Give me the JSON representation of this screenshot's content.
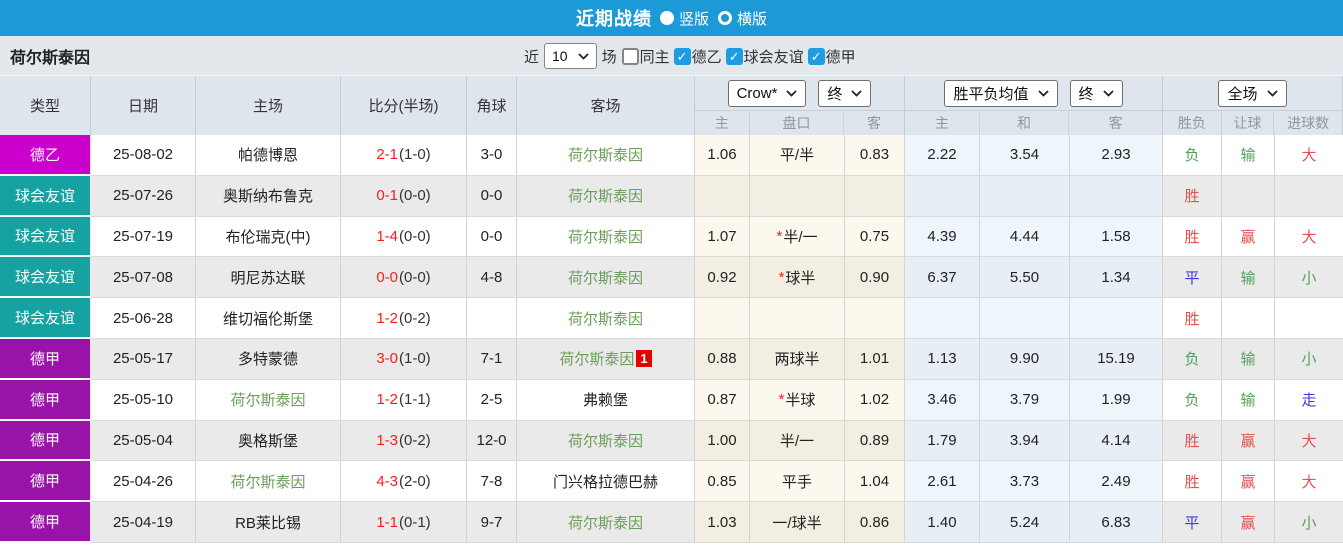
{
  "titlebar": {
    "title": "近期战绩",
    "radios": [
      {
        "label": "竖版",
        "selected": true
      },
      {
        "label": "横版",
        "selected": false
      }
    ]
  },
  "filterbar": {
    "team": "荷尔斯泰因",
    "recent_label": "近",
    "recent_value": "10",
    "games_label": "场",
    "checkboxes": [
      {
        "label": "同主",
        "checked": false
      },
      {
        "label": "德乙",
        "checked": true
      },
      {
        "label": "球会友谊",
        "checked": true
      },
      {
        "label": "德甲",
        "checked": true
      }
    ]
  },
  "table": {
    "headers": {
      "type": "类型",
      "date": "日期",
      "home": "主场",
      "score": "比分(半场)",
      "corner": "角球",
      "away": "客场",
      "odds_sub": [
        "主",
        "盘口",
        "客"
      ],
      "avg_sub": [
        "主",
        "和",
        "客"
      ],
      "result_sub": [
        "胜负",
        "让球",
        "进球数"
      ]
    },
    "dropdowns": {
      "odds_company": "Crow*",
      "odds_final": "终",
      "avg": "胜平负均值",
      "avg_final": "终",
      "scope": "全场"
    },
    "rows": [
      {
        "type": "德乙",
        "type_color": "#cc00cc",
        "date": "25-08-02",
        "home": "帕德博恩",
        "home_team": false,
        "ft": "2-1",
        "ht": "(1-0)",
        "corner": "3-0",
        "away": "荷尔斯泰因",
        "away_team": true,
        "badge": "",
        "o1": "1.06",
        "star": false,
        "line": "平/半",
        "o3": "0.83",
        "a1": "2.22",
        "a2": "3.54",
        "a3": "2.93",
        "result": "负",
        "result_color": "green",
        "handicap": "输",
        "handicap_color": "green",
        "goals": "大",
        "goals_color": "red"
      },
      {
        "type": "球会友谊",
        "type_color": "#17a2a2",
        "date": "25-07-26",
        "home": "奥斯纳布鲁克",
        "home_team": false,
        "ft": "0-1",
        "ht": "(0-0)",
        "corner": "0-0",
        "away": "荷尔斯泰因",
        "away_team": true,
        "badge": "",
        "o1": "",
        "star": false,
        "line": "",
        "o3": "",
        "a1": "",
        "a2": "",
        "a3": "",
        "result": "胜",
        "result_color": "red",
        "handicap": "",
        "handicap_color": "",
        "goals": "",
        "goals_color": ""
      },
      {
        "type": "球会友谊",
        "type_color": "#17a2a2",
        "date": "25-07-19",
        "home": "布伦瑞克(中)",
        "home_team": false,
        "ft": "1-4",
        "ht": "(0-0)",
        "corner": "0-0",
        "away": "荷尔斯泰因",
        "away_team": true,
        "badge": "",
        "o1": "1.07",
        "star": true,
        "line": "半/一",
        "o3": "0.75",
        "a1": "4.39",
        "a2": "4.44",
        "a3": "1.58",
        "result": "胜",
        "result_color": "red",
        "handicap": "赢",
        "handicap_color": "red",
        "goals": "大",
        "goals_color": "red"
      },
      {
        "type": "球会友谊",
        "type_color": "#17a2a2",
        "date": "25-07-08",
        "home": "明尼苏达联",
        "home_team": false,
        "ft": "0-0",
        "ht": "(0-0)",
        "corner": "4-8",
        "away": "荷尔斯泰因",
        "away_team": true,
        "badge": "",
        "o1": "0.92",
        "star": true,
        "line": "球半",
        "o3": "0.90",
        "a1": "6.37",
        "a2": "5.50",
        "a3": "1.34",
        "result": "平",
        "result_color": "blue",
        "handicap": "输",
        "handicap_color": "green",
        "goals": "小",
        "goals_color": "green"
      },
      {
        "type": "球会友谊",
        "type_color": "#17a2a2",
        "date": "25-06-28",
        "home": "维切福伦斯堡",
        "home_team": false,
        "ft": "1-2",
        "ht": "(0-2)",
        "corner": "",
        "away": "荷尔斯泰因",
        "away_team": true,
        "badge": "",
        "o1": "",
        "star": false,
        "line": "",
        "o3": "",
        "a1": "",
        "a2": "",
        "a3": "",
        "result": "胜",
        "result_color": "red",
        "handicap": "",
        "handicap_color": "",
        "goals": "",
        "goals_color": ""
      },
      {
        "type": "德甲",
        "type_color": "#9913a8",
        "date": "25-05-17",
        "home": "多特蒙德",
        "home_team": false,
        "ft": "3-0",
        "ht": "(1-0)",
        "corner": "7-1",
        "away": "荷尔斯泰因",
        "away_team": true,
        "badge": "1",
        "o1": "0.88",
        "star": false,
        "line": "两球半",
        "o3": "1.01",
        "a1": "1.13",
        "a2": "9.90",
        "a3": "15.19",
        "result": "负",
        "result_color": "green",
        "handicap": "输",
        "handicap_color": "green",
        "goals": "小",
        "goals_color": "green"
      },
      {
        "type": "德甲",
        "type_color": "#9913a8",
        "date": "25-05-10",
        "home": "荷尔斯泰因",
        "home_team": true,
        "ft": "1-2",
        "ht": "(1-1)",
        "corner": "2-5",
        "away": "弗赖堡",
        "away_team": false,
        "badge": "",
        "o1": "0.87",
        "star": true,
        "line": "半球",
        "o3": "1.02",
        "a1": "3.46",
        "a2": "3.79",
        "a3": "1.99",
        "result": "负",
        "result_color": "green",
        "handicap": "输",
        "handicap_color": "green",
        "goals": "走",
        "goals_color": "blue"
      },
      {
        "type": "德甲",
        "type_color": "#9913a8",
        "date": "25-05-04",
        "home": "奥格斯堡",
        "home_team": false,
        "ft": "1-3",
        "ht": "(0-2)",
        "corner": "12-0",
        "away": "荷尔斯泰因",
        "away_team": true,
        "badge": "",
        "o1": "1.00",
        "star": false,
        "line": "半/一",
        "o3": "0.89",
        "a1": "1.79",
        "a2": "3.94",
        "a3": "4.14",
        "result": "胜",
        "result_color": "red",
        "handicap": "赢",
        "handicap_color": "red",
        "goals": "大",
        "goals_color": "red"
      },
      {
        "type": "德甲",
        "type_color": "#9913a8",
        "date": "25-04-26",
        "home": "荷尔斯泰因",
        "home_team": true,
        "ft": "4-3",
        "ht": "(2-0)",
        "corner": "7-8",
        "away": "门兴格拉德巴赫",
        "away_team": false,
        "badge": "",
        "o1": "0.85",
        "star": false,
        "line": "平手",
        "o3": "1.04",
        "a1": "2.61",
        "a2": "3.73",
        "a3": "2.49",
        "result": "胜",
        "result_color": "red",
        "handicap": "赢",
        "handicap_color": "red",
        "goals": "大",
        "goals_color": "red"
      },
      {
        "type": "德甲",
        "type_color": "#9913a8",
        "date": "25-04-19",
        "home": "RB莱比锡",
        "home_team": false,
        "ft": "1-1",
        "ht": "(0-1)",
        "corner": "9-7",
        "away": "荷尔斯泰因",
        "away_team": true,
        "badge": "",
        "o1": "1.03",
        "star": false,
        "line": "一/球半",
        "o3": "0.86",
        "a1": "1.40",
        "a2": "5.24",
        "a3": "6.83",
        "result": "平",
        "result_color": "blue",
        "handicap": "赢",
        "handicap_color": "red",
        "goals": "小",
        "goals_color": "green"
      }
    ]
  },
  "colors": {
    "accent_blue": "#1b9ad7",
    "checkbox_blue": "#1e9ce4",
    "type_de2": "#cc00cc",
    "type_friendly": "#17a2a2",
    "type_de1": "#9913a8",
    "team_green": "#6b9e5a",
    "score_red": "#ff1a1a",
    "badge_red": "#e60000",
    "value_red": "#e4504f",
    "value_green": "#55a05c",
    "value_blue": "#3d3ddc"
  }
}
